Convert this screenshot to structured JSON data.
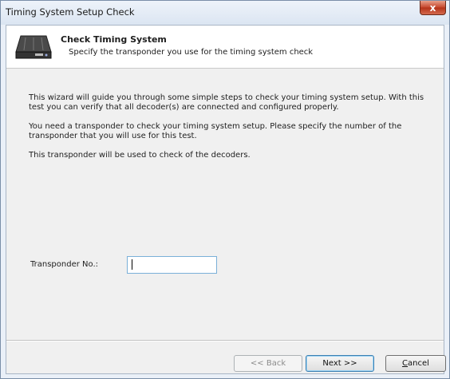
{
  "window": {
    "title": "Timing System Setup Check",
    "close_label": "x"
  },
  "header": {
    "title": "Check Timing System",
    "subtitle": "Specify the transponder you use for the timing system check",
    "icon": "timing-decoder-device-icon"
  },
  "body": {
    "paragraphs": [
      "This wizard will guide you through some simple steps to check your timing system setup. With this test you can verify that all decoder(s) are connected and configured properly.",
      "You need a transponder to check your timing system setup. Please specify the number of the transponder that you will use for this test.",
      "This transponder will be used to check of the decoders."
    ]
  },
  "form": {
    "transponder_label": "Transponder No.:",
    "transponder_value": ""
  },
  "buttons": {
    "back": "<< Back",
    "next": "Next >>",
    "cancel_first": "C",
    "cancel_rest": "ancel"
  },
  "colors": {
    "close_button": "#c5452b",
    "input_border": "#7ab0d8",
    "window_frame": "#dbe5f2"
  }
}
